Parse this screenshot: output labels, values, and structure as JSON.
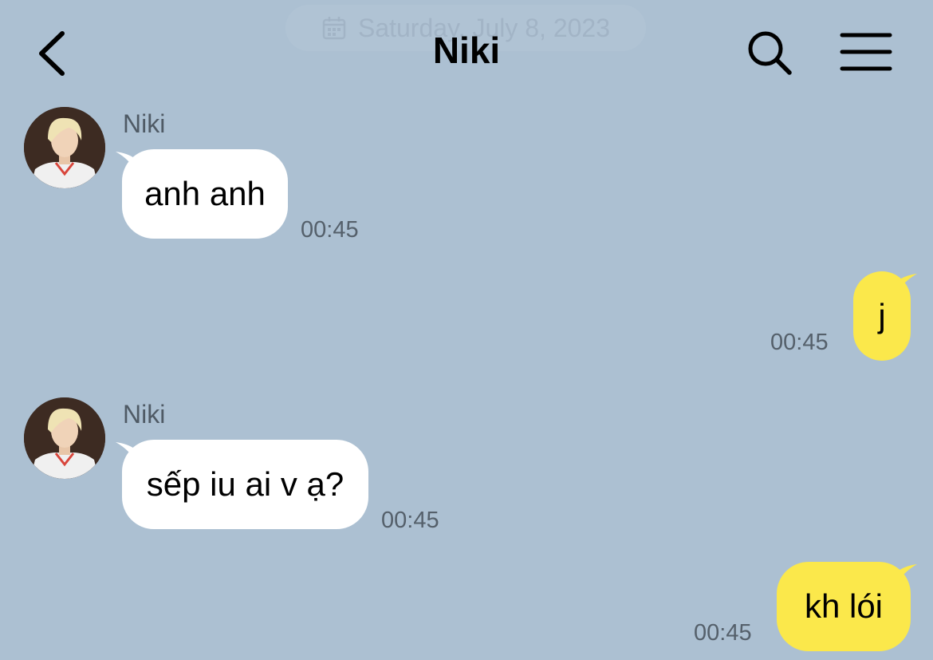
{
  "header": {
    "date": "Saturday, July 8, 2023",
    "title": "Niki"
  },
  "messages": [
    {
      "direction": "incoming",
      "sender": "Niki",
      "text": "anh anh",
      "time": "00:45"
    },
    {
      "direction": "outgoing",
      "text": "j",
      "time": "00:45"
    },
    {
      "direction": "incoming",
      "sender": "Niki",
      "text": "sếp iu ai v ạ?",
      "time": "00:45"
    },
    {
      "direction": "outgoing",
      "text": "kh lói",
      "time": "00:45"
    }
  ],
  "colors": {
    "background": "#acc0d2",
    "incoming_bubble": "#ffffff",
    "outgoing_bubble": "#fbe84b"
  },
  "icons": [
    "back-chevron-icon",
    "calendar-icon",
    "search-icon",
    "hamburger-menu-icon"
  ]
}
